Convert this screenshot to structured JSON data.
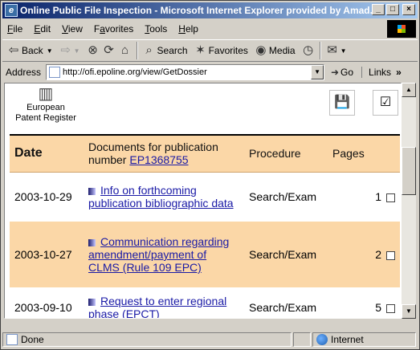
{
  "window": {
    "title": "Online Public File Inspection - Microsoft Internet Explorer provided by Amad...",
    "btn_min": "_",
    "btn_max": "□",
    "btn_close": "×"
  },
  "menu": [
    {
      "ul": "F",
      "rest": "ile"
    },
    {
      "ul": "E",
      "rest": "dit"
    },
    {
      "ul": "V",
      "rest": "iew"
    },
    {
      "ul": "F",
      "rest": "avorites",
      "prefix": "",
      "full": "Favorites"
    },
    {
      "ul": "T",
      "rest": "ools"
    },
    {
      "ul": "H",
      "rest": "elp"
    }
  ],
  "toolbar": {
    "back": "Back",
    "search": "Search",
    "favorites": "Favorites",
    "media": "Media"
  },
  "address": {
    "label": "Address",
    "url": "http://ofi.epoline.org/view/GetDossier",
    "go": "Go",
    "links": "Links"
  },
  "page": {
    "register_label_1": "European",
    "register_label_2": "Patent Register",
    "table": {
      "col_date": "Date",
      "col_docs_1": "Documents for publication",
      "col_docs_2": "number",
      "publication_number": "EP1368755",
      "col_procedure": "Procedure",
      "col_pages": "Pages",
      "rows": [
        {
          "date": "2003-10-29",
          "title": "Info on forthcoming publication bibliographic data",
          "procedure": "Search/Exam",
          "pages": "1"
        },
        {
          "date": "2003-10-27",
          "title": "Communication regarding amendment/payment of CLMS (Rule 109 EPC)",
          "procedure": "Search/Exam",
          "pages": "2"
        },
        {
          "date": "2003-09-10",
          "title": "Request to enter regional phase (EPCT)",
          "procedure": "Search/Exam",
          "pages": "5"
        }
      ]
    }
  },
  "status": {
    "left": "Done",
    "zone": "Internet"
  }
}
